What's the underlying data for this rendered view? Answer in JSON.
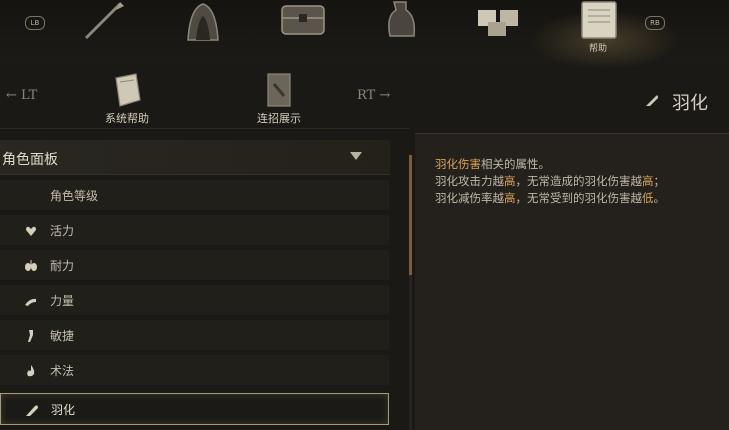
{
  "top_tabs": {
    "lb_label": "LB",
    "rb_label": "RB",
    "active_label": "帮助",
    "icons": [
      "spear-icon",
      "hood-icon",
      "chest-icon",
      "bottle-icon",
      "boxes-icon",
      "scroll-icon"
    ]
  },
  "sub_nav": {
    "left_hint": "LT",
    "right_hint": "RT",
    "tabs": [
      {
        "label": "系统帮助"
      },
      {
        "label": "连招展示"
      }
    ]
  },
  "detail": {
    "title": "羽化",
    "line1_hl": "羽化伤害",
    "line1_rest": "相关的属性。",
    "line2_a": "羽化攻击力越",
    "line2_b": "高",
    "line2_c": "，无常造成的羽化伤害越",
    "line2_d": "高",
    "line2_e": "；",
    "line3_a": "羽化减伤率越",
    "line3_b": "高",
    "line3_c": "，无常受到的羽化伤害越",
    "line3_d": "低",
    "line3_e": "。"
  },
  "panel": {
    "section_title": "角色面板",
    "items": [
      {
        "label": "角色等级",
        "icon": ""
      },
      {
        "label": "活力",
        "icon": "heart-icon"
      },
      {
        "label": "耐力",
        "icon": "lungs-icon"
      },
      {
        "label": "力量",
        "icon": "arm-icon"
      },
      {
        "label": "敏捷",
        "icon": "feet-icon"
      },
      {
        "label": "术法",
        "icon": "flame-icon"
      },
      {
        "label": "羽化",
        "icon": "feather-icon"
      }
    ],
    "selected_index": 6
  },
  "colors": {
    "highlight": "#d9a35a",
    "selection_border": "#a69a7c",
    "background": "#1b1915"
  }
}
